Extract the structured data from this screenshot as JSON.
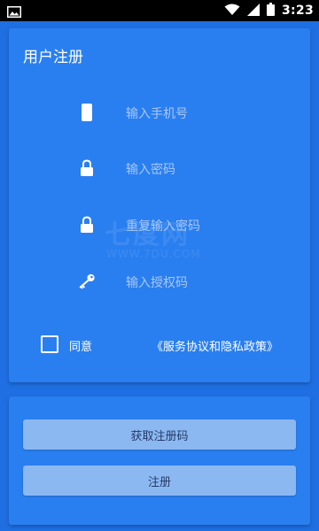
{
  "status_bar": {
    "time": "3:23",
    "icons": [
      "image-icon",
      "wifi-icon",
      "signal-icon",
      "battery-icon"
    ]
  },
  "register": {
    "title": "用户注册",
    "phone_placeholder": "输入手机号",
    "password_placeholder": "输入密码",
    "confirm_password_placeholder": "重复输入密码",
    "auth_code_placeholder": "输入授权码",
    "agree_label": "同意",
    "policy_link": "《服务协议和隐私政策》"
  },
  "watermark": {
    "main": "七度网",
    "sub": "WWW.7DU.COM"
  },
  "actions": {
    "get_code_label": "获取注册码",
    "register_label": "注册"
  },
  "colors": {
    "background": "#1f6fe3",
    "card": "#2a7ff0",
    "button": "#8cb8f2",
    "placeholder": "#a7c7f6"
  }
}
